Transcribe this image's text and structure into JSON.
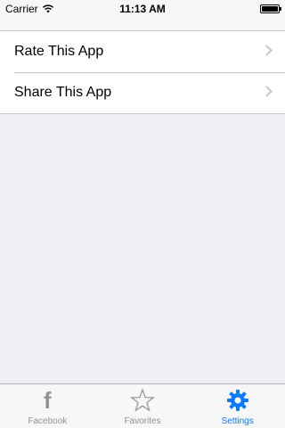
{
  "status_bar": {
    "carrier": "Carrier",
    "time": "11:13 AM",
    "battery_level": 1.0
  },
  "settings_list": {
    "items": [
      {
        "label": "Rate This App",
        "icon": "chevron-right-icon"
      },
      {
        "label": "Share This App",
        "icon": "chevron-right-icon"
      }
    ]
  },
  "tab_bar": {
    "tabs": [
      {
        "label": "Facebook",
        "icon": "facebook-icon",
        "active": false
      },
      {
        "label": "Favorites",
        "icon": "star-icon",
        "active": false
      },
      {
        "label": "Settings",
        "icon": "gear-icon",
        "active": true
      }
    ]
  },
  "colors": {
    "accent": "#0a7aff",
    "inactive": "#929292",
    "background": "#efeff4",
    "separator": "#c8c7cc"
  }
}
